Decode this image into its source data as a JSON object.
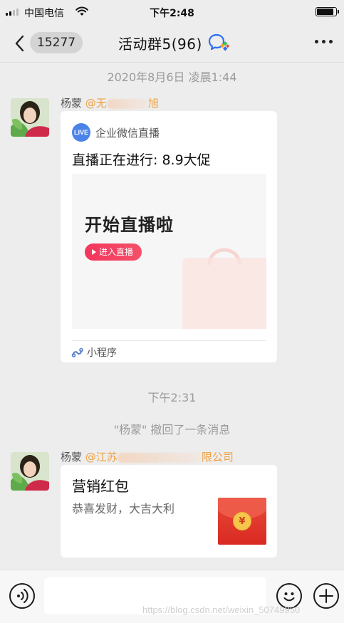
{
  "status_bar": {
    "carrier": "中国电信",
    "time": "下午2:48"
  },
  "nav": {
    "unread_count": "15277",
    "title": "活动群5(96)"
  },
  "messages": {
    "timestamp_1": "2020年8月6日 凌晨1:44",
    "live_card": {
      "sender": "杨蒙",
      "mention_prefix": "@无",
      "mention_suffix": "旭",
      "logo_text": "LIVE",
      "source": "企业微信直播",
      "title": "直播正在进行: 8.9大促",
      "banner_headline": "开始直播啦",
      "enter_button": "进入直播",
      "footer_label": "小程序"
    },
    "timestamp_2": "下午2:31",
    "recall_notice": "\"杨蒙\" 撤回了一条消息",
    "red_packet": {
      "sender": "杨蒙",
      "mention_prefix": "@江苏",
      "mention_suffix": "限公司",
      "title": "营销红包",
      "subtitle": "恭喜发财，大吉大利",
      "coin_symbol": "¥"
    }
  },
  "watermark": "https://blog.csdn.net/weixin_50749950",
  "colors": {
    "background": "#ededed",
    "mention": "#f0a040",
    "live_blue": "#4b83e8",
    "enter_button_red": "#f2365c",
    "red_packet": "#e03a2c"
  }
}
